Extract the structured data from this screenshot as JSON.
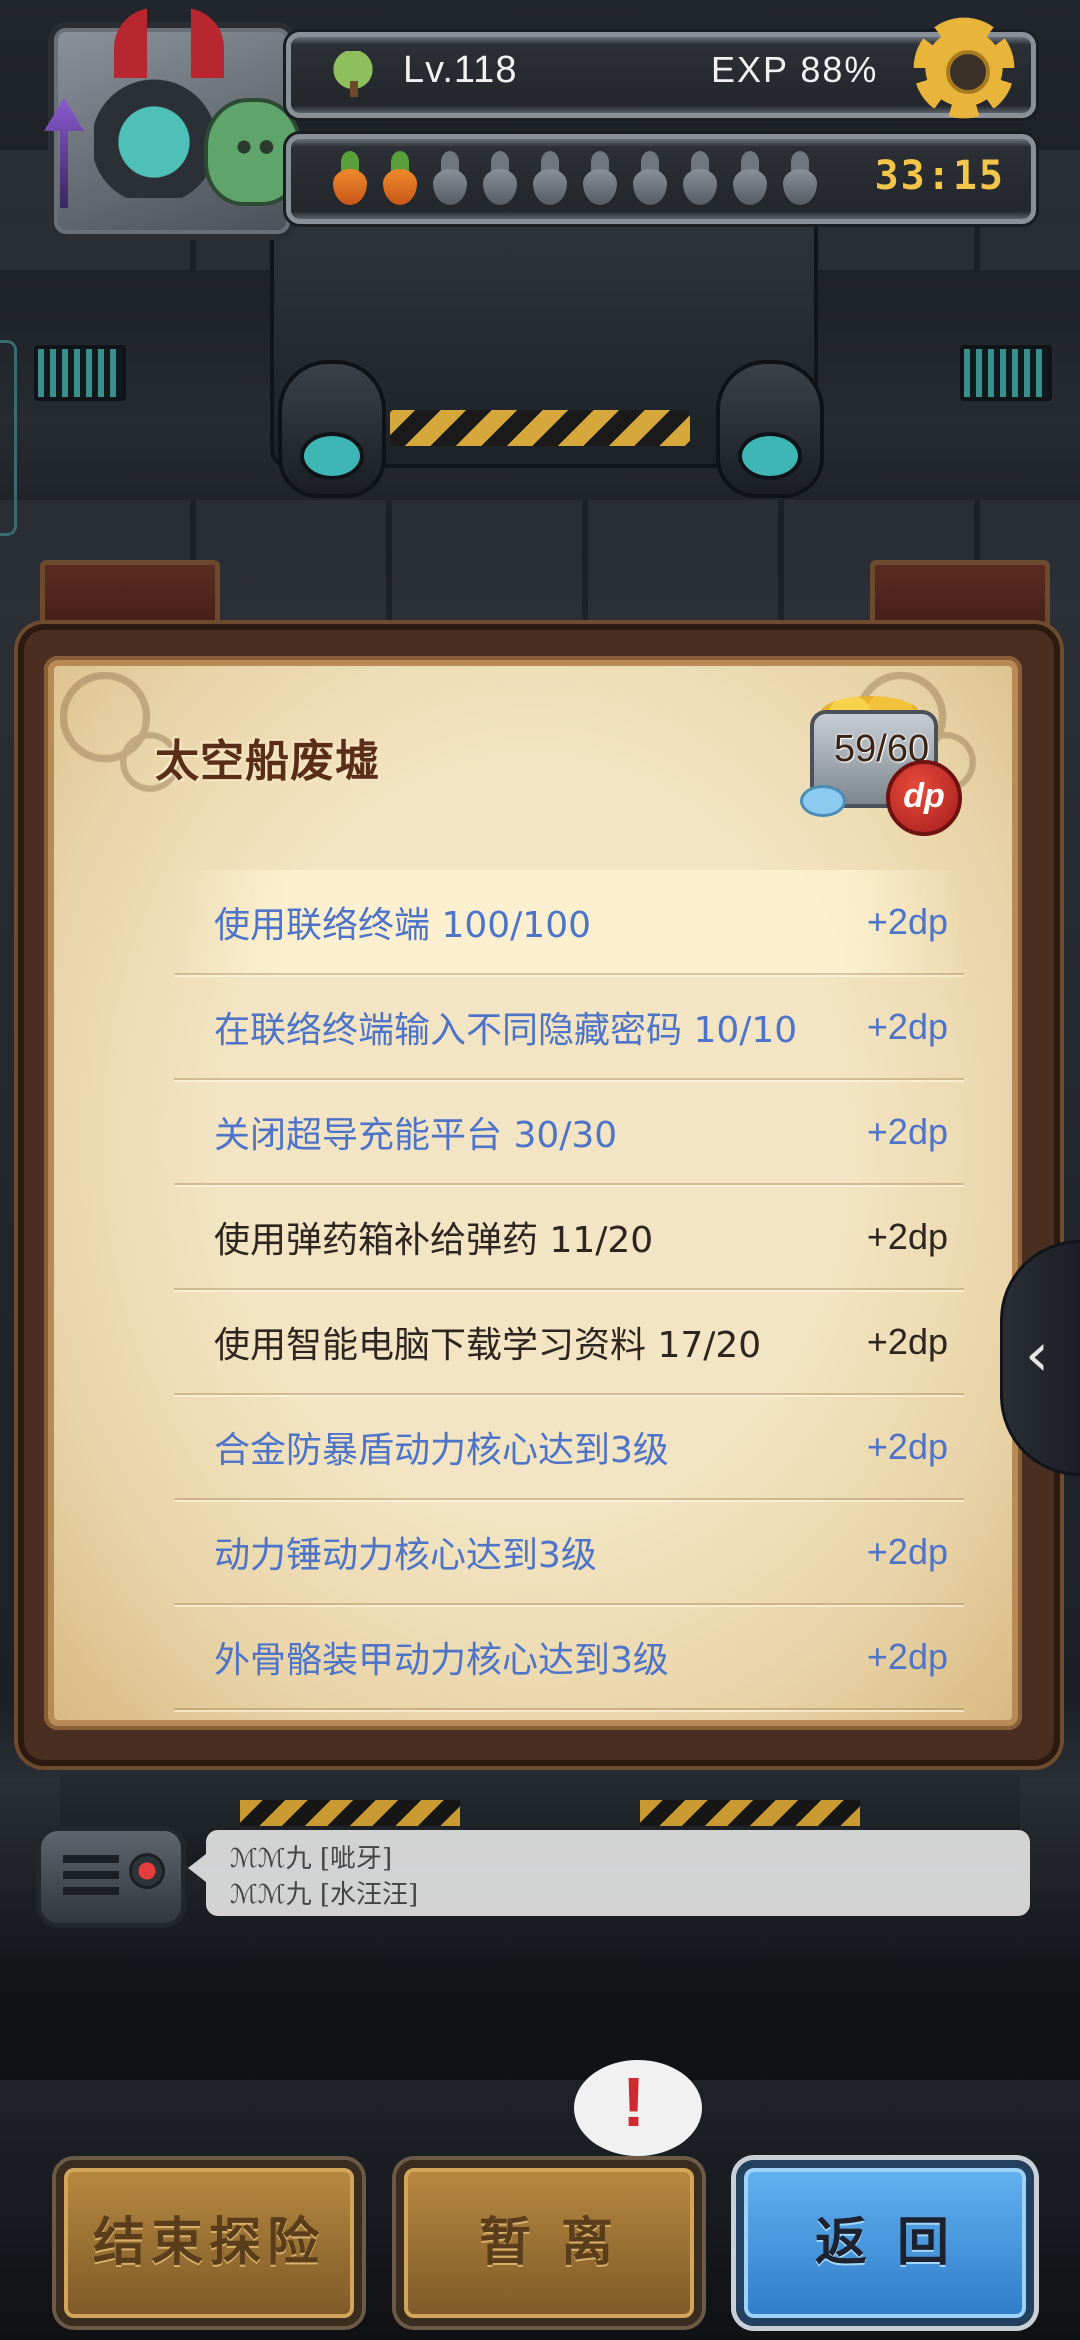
{
  "hud": {
    "level": "Lv.118",
    "exp": "EXP  88%",
    "timer": "33:15",
    "stamina": {
      "filled": 2,
      "total": 10
    }
  },
  "quest": {
    "title": "太空船废墟",
    "progress": "59/60",
    "badge": "dp",
    "tasks": [
      {
        "name": "使用联络终端 100/100",
        "reward": "+2dp",
        "status": "done"
      },
      {
        "name": "在联络终端输入不同隐藏密码 10/10",
        "reward": "+2dp",
        "status": "done"
      },
      {
        "name": "关闭超导充能平台 30/30",
        "reward": "+2dp",
        "status": "done"
      },
      {
        "name": "使用弹药箱补给弹药 11/20",
        "reward": "+2dp",
        "status": "pending"
      },
      {
        "name": "使用智能电脑下载学习资料 17/20",
        "reward": "+2dp",
        "status": "pending"
      },
      {
        "name": "合金防暴盾动力核心达到3级",
        "reward": "+2dp",
        "status": "done"
      },
      {
        "name": "动力锤动力核心达到3级",
        "reward": "+2dp",
        "status": "done"
      },
      {
        "name": "外骨骼装甲动力核心达到3级",
        "reward": "+2dp",
        "status": "done"
      }
    ]
  },
  "side_tab": {
    "arrow": "‹"
  },
  "chat": {
    "messages": [
      "ℳℳ九  [呲牙]",
      "ℳℳ九  [水汪汪]"
    ]
  },
  "alert": {
    "symbol": "!"
  },
  "buttons": {
    "end": "结束探险",
    "away": "暂 离",
    "back": "返 回"
  },
  "colors": {
    "done_text": "#4d74c8",
    "pending_text": "#2c2520",
    "timer": "#f3c64a",
    "back_button": "#4a9be0"
  }
}
